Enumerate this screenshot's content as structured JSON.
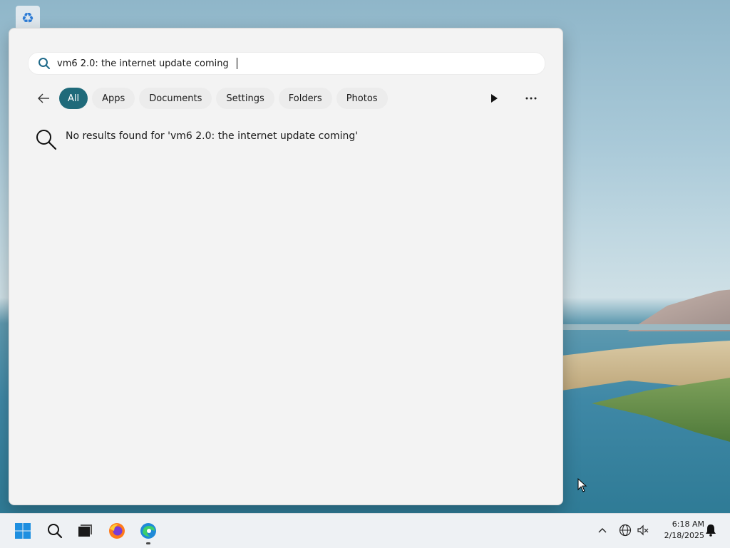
{
  "desktop": {
    "icon_name": "recycle-bin-icon"
  },
  "search": {
    "query": "vm6 2.0: the internet update coming",
    "filters": [
      "All",
      "Apps",
      "Documents",
      "Settings",
      "Folders",
      "Photos"
    ],
    "active_filter": "All",
    "no_results_text": "No results found for 'vm6 2.0: the internet update coming'"
  },
  "taskbar": {
    "apps": [
      "start-icon",
      "search-icon",
      "task-view-icon",
      "firefox-icon",
      "edge-icon"
    ],
    "clock_time": "6:18 AM",
    "clock_date": "2/18/2025"
  },
  "colors": {
    "accent": "#1f6a7a",
    "panel_bg": "#f3f3f3",
    "taskbar_bg": "#eef1f4"
  }
}
